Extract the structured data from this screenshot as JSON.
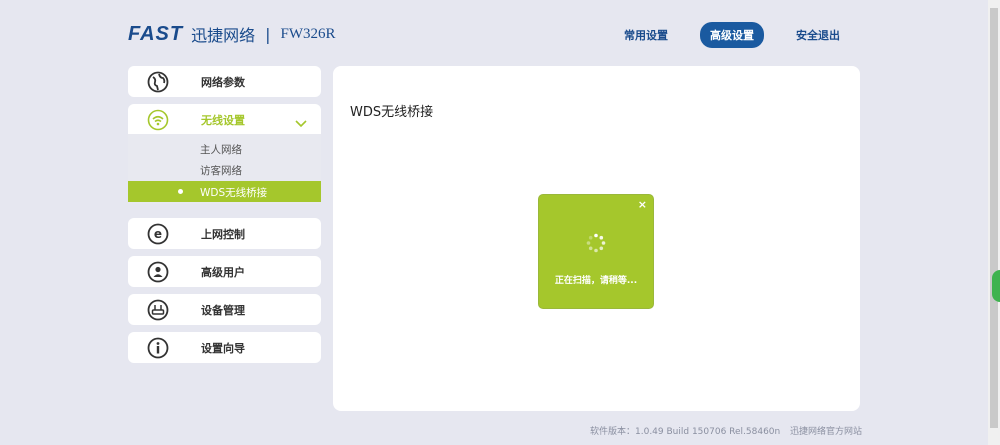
{
  "header": {
    "brand": "FAST",
    "brand_cn": "迅捷网络",
    "separator": "|",
    "model": "FW326R"
  },
  "topnav": [
    {
      "label": "常用设置",
      "active": false
    },
    {
      "label": "高级设置",
      "active": true
    },
    {
      "label": "安全退出",
      "active": false
    }
  ],
  "sidebar": {
    "items": [
      {
        "label": "网络参数",
        "icon": "globe-icon"
      },
      {
        "label": "无线设置",
        "icon": "wifi-icon",
        "open": true
      },
      {
        "label": "上网控制",
        "icon": "e-icon"
      },
      {
        "label": "高级用户",
        "icon": "user-icon"
      },
      {
        "label": "设备管理",
        "icon": "router-icon"
      },
      {
        "label": "设置向导",
        "icon": "info-icon"
      }
    ],
    "submenu": [
      "主人网络",
      "访客网络",
      "WDS无线桥接"
    ],
    "active_sub": "WDS无线桥接"
  },
  "main": {
    "title": "WDS无线桥接",
    "dialog": {
      "close": "×",
      "message": "正在扫描，请稍等..."
    }
  },
  "footer": {
    "version": "软件版本：1.0.49 Build 150706 Rel.58460n",
    "site": "迅捷网络官方网站"
  },
  "colors": {
    "accent": "#a5c72c",
    "brand": "#1a4b8c",
    "background": "#e6e7f0"
  }
}
